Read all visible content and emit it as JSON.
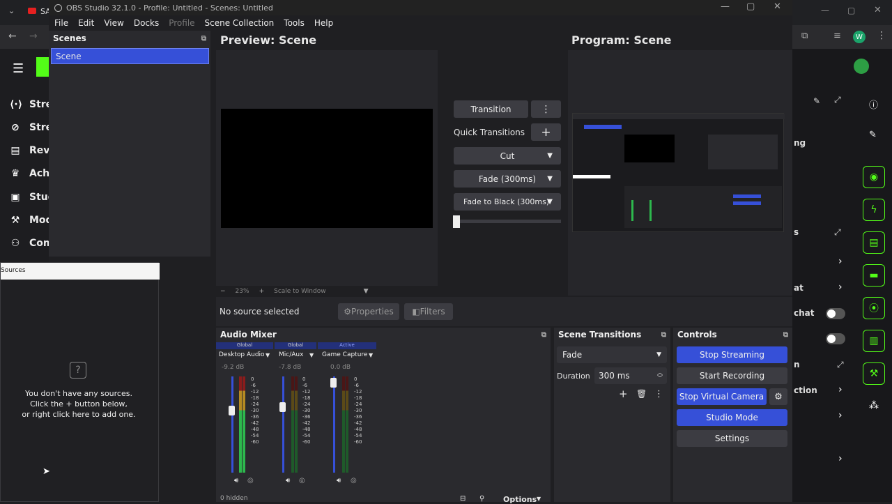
{
  "chrome": {
    "tab_text": "SA",
    "avatar_letter": "W"
  },
  "kick_sidebar": {
    "items": [
      {
        "label": "Stre",
        "icon": "broadcast-icon"
      },
      {
        "label": "Stre",
        "icon": "link-icon"
      },
      {
        "label": "Reve",
        "icon": "chart-icon"
      },
      {
        "label": "Achi",
        "icon": "trophy-icon"
      },
      {
        "label": "Stud",
        "icon": "studio-icon"
      },
      {
        "label": "Mod",
        "icon": "wrench-icon"
      },
      {
        "label": "Com",
        "icon": "people-icon"
      }
    ]
  },
  "kick_right": {
    "texts": [
      "ng",
      "s",
      "at",
      "chat",
      "n",
      "ction"
    ]
  },
  "obs": {
    "title": "OBS Studio 32.1.0 - Profile: Untitled - Scenes: Untitled",
    "menu": [
      "File",
      "Edit",
      "View",
      "Docks",
      "Profile",
      "Scene Collection",
      "Tools",
      "Help"
    ],
    "scenes_header": "Scenes",
    "scene_items": [
      "Scene"
    ],
    "preview_title": "Preview: Scene",
    "program_title": "Program: Scene",
    "transition_label": "Transition",
    "quick_transitions": "Quick Transitions",
    "quick_items": [
      "Cut",
      "Fade (300ms)",
      "Fade to Black (300ms)"
    ],
    "zoom": "23%",
    "scale_mode": "Scale to Window",
    "no_source": "No source selected",
    "properties": "Properties",
    "filters": "Filters",
    "sources_header": "Sources",
    "sources_empty": [
      "You don't have any sources.",
      "Click the + button below,",
      "or right click here to add one."
    ],
    "audio_mixer": "Audio Mixer",
    "channels": [
      {
        "tag": "Global",
        "name": "Desktop Audio",
        "db": "-9.2 dB"
      },
      {
        "tag": "Global",
        "name": "Mic/Aux",
        "db": "-7.8 dB"
      },
      {
        "tag": "Active",
        "name": "Game Capture",
        "db": "0.0 dB"
      }
    ],
    "meter_scale": [
      "0",
      "-6",
      "-12",
      "-18",
      "-24",
      "-30",
      "-36",
      "-42",
      "-48",
      "-54",
      "-60"
    ],
    "hidden": "0 hidden",
    "options": "Options",
    "scene_transitions": "Scene Transitions",
    "transition_select": "Fade",
    "duration_label": "Duration",
    "duration_value": "300 ms",
    "controls": "Controls",
    "stop_streaming": "Stop Streaming",
    "start_recording": "Start Recording",
    "stop_virtual_camera": "Stop Virtual Camera",
    "studio_mode": "Studio Mode",
    "settings": "Settings"
  }
}
